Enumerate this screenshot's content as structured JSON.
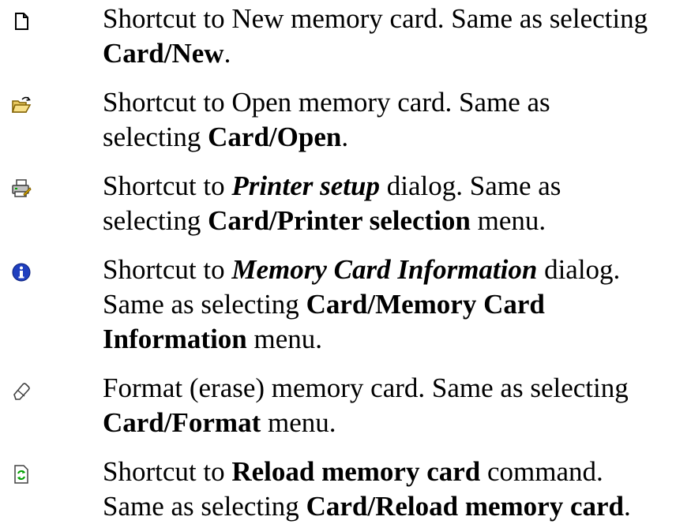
{
  "entries": [
    {
      "icon": "new-document-icon",
      "lines": [
        [
          {
            "t": "Shortcut to New memory card. Same as selecting",
            "s": ""
          }
        ],
        [
          {
            "t": "Card/New",
            "s": "b"
          },
          {
            "t": ".",
            "s": ""
          }
        ]
      ]
    },
    {
      "icon": "open-folder-icon",
      "lines": [
        [
          {
            "t": "Shortcut to Open memory card. Same as",
            "s": ""
          }
        ],
        [
          {
            "t": "selecting ",
            "s": ""
          },
          {
            "t": "Card/Open",
            "s": "b"
          },
          {
            "t": ".",
            "s": ""
          }
        ]
      ]
    },
    {
      "icon": "printer-setup-icon",
      "lines": [
        [
          {
            "t": "Shortcut to ",
            "s": ""
          },
          {
            "t": "Printer setup",
            "s": "bi"
          },
          {
            "t": " dialog. Same as",
            "s": ""
          }
        ],
        [
          {
            "t": "selecting ",
            "s": ""
          },
          {
            "t": "Card/Printer selection",
            "s": "b"
          },
          {
            "t": " menu.",
            "s": ""
          }
        ]
      ]
    },
    {
      "icon": "info-icon",
      "lines": [
        [
          {
            "t": "Shortcut to ",
            "s": ""
          },
          {
            "t": "Memory Card Information",
            "s": "bi"
          },
          {
            "t": " dialog.",
            "s": ""
          }
        ],
        [
          {
            "t": "Same as selecting ",
            "s": ""
          },
          {
            "t": "Card/Memory Card",
            "s": "b"
          }
        ],
        [
          {
            "t": "Information",
            "s": "b"
          },
          {
            "t": " menu.",
            "s": ""
          }
        ]
      ]
    },
    {
      "icon": "eraser-icon",
      "lines": [
        [
          {
            "t": "Format (erase) memory card. Same as selecting",
            "s": ""
          }
        ],
        [
          {
            "t": "Card/Format",
            "s": "b"
          },
          {
            "t": " menu.",
            "s": ""
          }
        ]
      ]
    },
    {
      "icon": "reload-icon",
      "lines": [
        [
          {
            "t": "Shortcut to ",
            "s": ""
          },
          {
            "t": "Reload memory card",
            "s": "b"
          },
          {
            "t": " command.",
            "s": ""
          }
        ],
        [
          {
            "t": "Same as selecting ",
            "s": ""
          },
          {
            "t": "Card/Reload memory card",
            "s": "b"
          },
          {
            "t": ".",
            "s": ""
          }
        ]
      ]
    }
  ]
}
